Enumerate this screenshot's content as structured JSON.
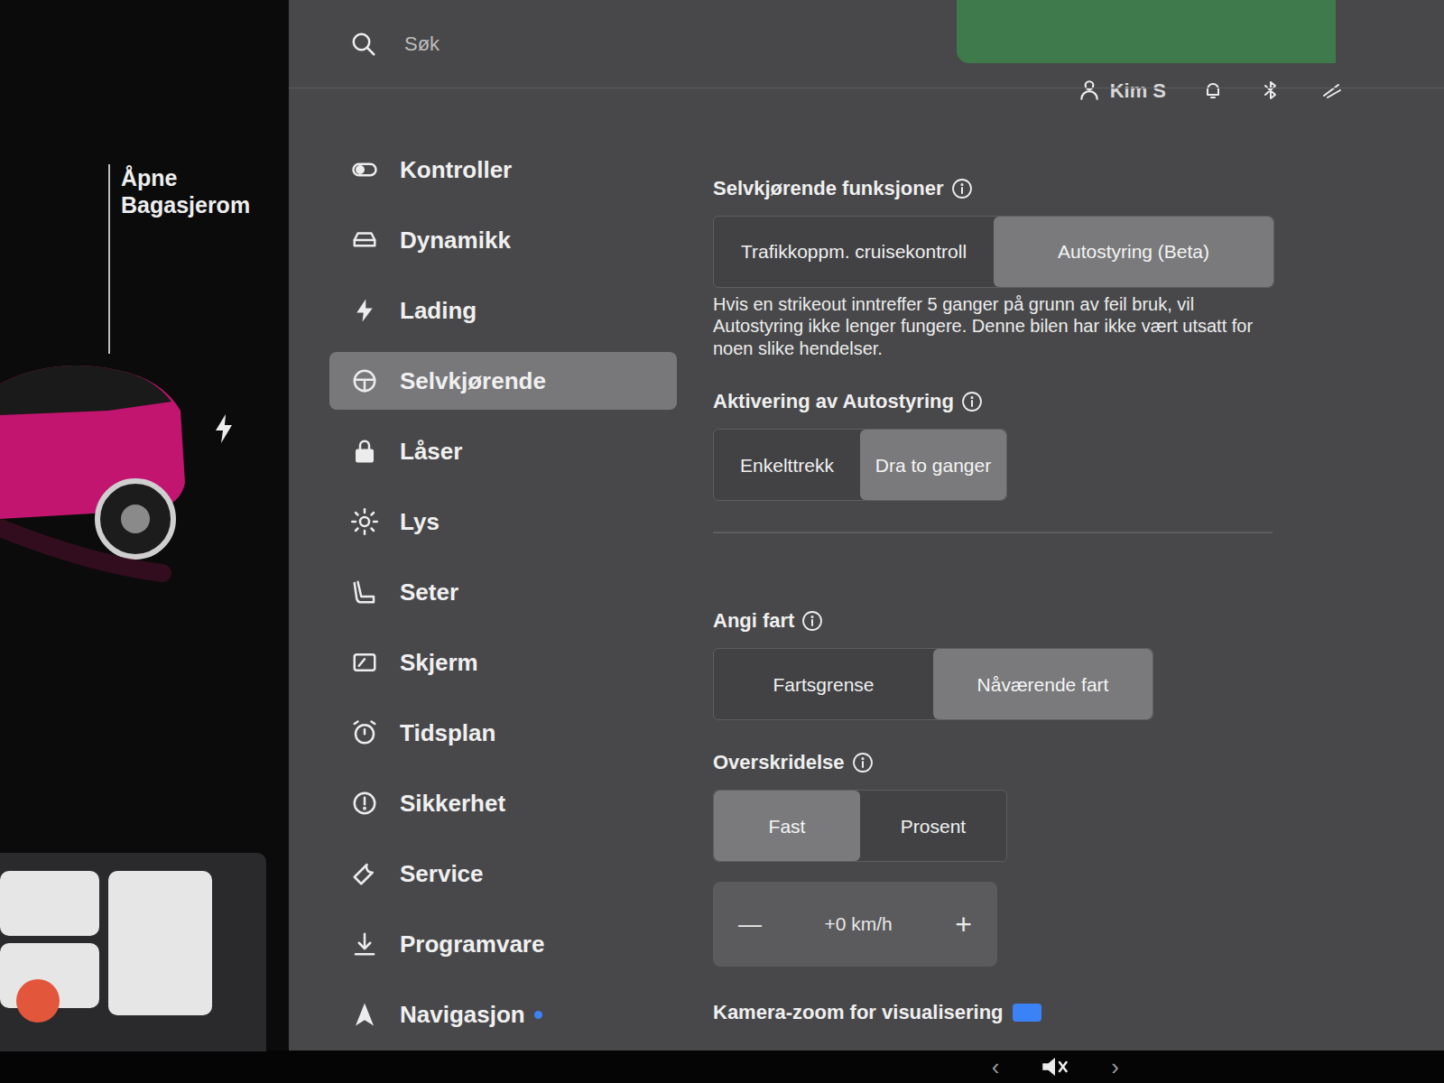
{
  "search": {
    "placeholder": "Søk"
  },
  "profile": {
    "name": "Kim S"
  },
  "car_panel": {
    "trunk_label": [
      "Åpne",
      "Bagasjerom"
    ]
  },
  "menu": [
    {
      "label": "Kontroller",
      "selected": false,
      "dot": false
    },
    {
      "label": "Dynamikk",
      "selected": false,
      "dot": false
    },
    {
      "label": "Lading",
      "selected": false,
      "dot": false
    },
    {
      "label": "Selvkjørende",
      "selected": true,
      "dot": false
    },
    {
      "label": "Låser",
      "selected": false,
      "dot": false
    },
    {
      "label": "Lys",
      "selected": false,
      "dot": false
    },
    {
      "label": "Seter",
      "selected": false,
      "dot": false
    },
    {
      "label": "Skjerm",
      "selected": false,
      "dot": false
    },
    {
      "label": "Tidsplan",
      "selected": false,
      "dot": false
    },
    {
      "label": "Sikkerhet",
      "selected": false,
      "dot": false
    },
    {
      "label": "Service",
      "selected": false,
      "dot": false
    },
    {
      "label": "Programvare",
      "selected": false,
      "dot": false
    },
    {
      "label": "Navigasjon",
      "selected": false,
      "dot": true
    }
  ],
  "sections": [
    {
      "kind": "segmented",
      "title": "Selvkjørende funksjoner",
      "info": true,
      "size": "wide",
      "options": [
        {
          "label": "Trafikkoppm. cruisekontroll",
          "selected": false
        },
        {
          "label": "Autostyring (Beta)",
          "selected": true
        }
      ],
      "note": "Hvis en strikeout inntreffer 5 ganger på grunn av feil bruk, vil Autostyring ikke lenger fungere. Denne bilen har ikke vært utsatt for noen slike hendelser."
    },
    {
      "kind": "segmented",
      "title": "Aktivering av Autostyring",
      "info": true,
      "size": "small",
      "options": [
        {
          "label": "Enkelttrekk",
          "selected": false
        },
        {
          "label": "Dra to ganger",
          "selected": true
        }
      ]
    },
    {
      "kind": "divider"
    },
    {
      "kind": "segmented",
      "title": "Angi fart",
      "info": true,
      "size": "medium",
      "options": [
        {
          "label": "Fartsgrense",
          "selected": false
        },
        {
          "label": "Nåværende fart",
          "selected": true
        }
      ]
    },
    {
      "kind": "segmented",
      "title": "Overskridelse",
      "info": true,
      "size": "small",
      "options": [
        {
          "label": "Fast",
          "selected": true
        },
        {
          "label": "Prosent",
          "selected": false
        }
      ]
    },
    {
      "kind": "stepper",
      "minus": "—",
      "value": "+0 km/h",
      "plus": "+"
    },
    {
      "kind": "header",
      "title": "Kamera-zoom for visualisering",
      "badge": true
    }
  ],
  "bottom_bar": {
    "prev": "‹",
    "next": "›",
    "muted": true
  }
}
